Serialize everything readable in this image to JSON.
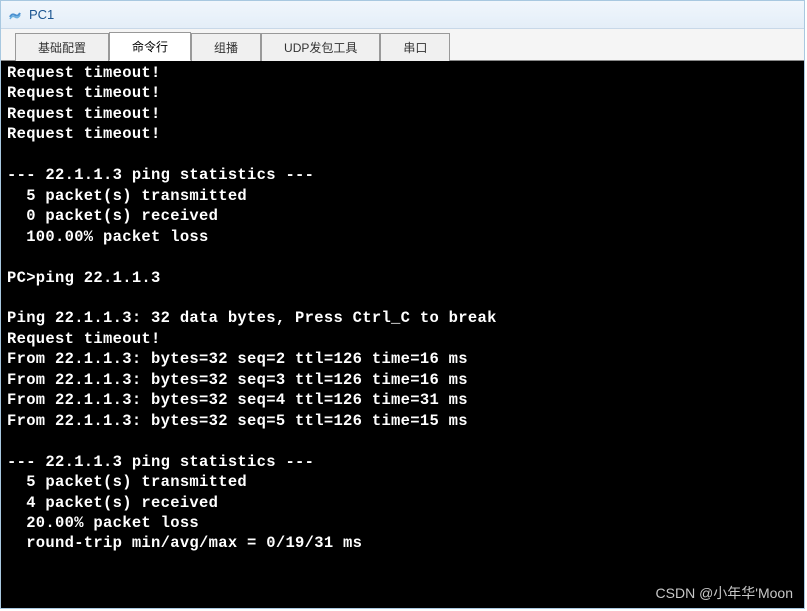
{
  "window": {
    "title": "PC1"
  },
  "tabs": [
    {
      "label": "基础配置"
    },
    {
      "label": "命令行"
    },
    {
      "label": "组播"
    },
    {
      "label": "UDP发包工具"
    },
    {
      "label": "串口"
    }
  ],
  "terminal": {
    "lines": [
      "Request timeout!",
      "Request timeout!",
      "Request timeout!",
      "Request timeout!",
      "",
      "--- 22.1.1.3 ping statistics ---",
      "  5 packet(s) transmitted",
      "  0 packet(s) received",
      "  100.00% packet loss",
      "",
      "PC>ping 22.1.1.3",
      "",
      "Ping 22.1.1.3: 32 data bytes, Press Ctrl_C to break",
      "Request timeout!",
      "From 22.1.1.3: bytes=32 seq=2 ttl=126 time=16 ms",
      "From 22.1.1.3: bytes=32 seq=3 ttl=126 time=16 ms",
      "From 22.1.1.3: bytes=32 seq=4 ttl=126 time=31 ms",
      "From 22.1.1.3: bytes=32 seq=5 ttl=126 time=15 ms",
      "",
      "--- 22.1.1.3 ping statistics ---",
      "  5 packet(s) transmitted",
      "  4 packet(s) received",
      "  20.00% packet loss",
      "  round-trip min/avg/max = 0/19/31 ms"
    ]
  },
  "watermark": "CSDN @小年华'Moon"
}
